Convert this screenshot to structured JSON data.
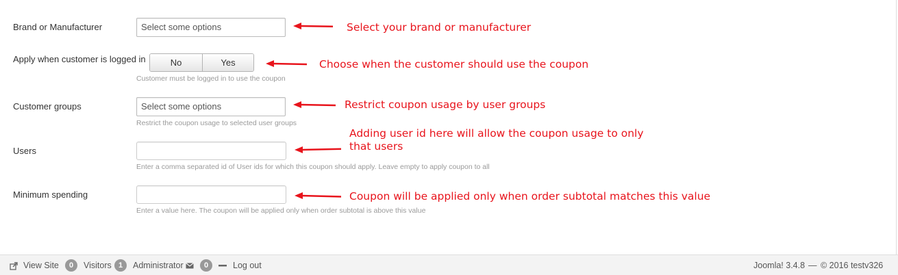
{
  "form": {
    "brand": {
      "label": "Brand or Manufacturer",
      "placeholder": "Select some options"
    },
    "logged_in": {
      "label": "Apply when customer is logged in",
      "options": [
        "No",
        "Yes"
      ],
      "help": "Customer must be logged in to use the coupon"
    },
    "customer_groups": {
      "label": "Customer groups",
      "placeholder": "Select some options",
      "help": "Restrict the coupon usage to selected user groups"
    },
    "users": {
      "label": "Users",
      "value": "",
      "help": "Enter a comma separated id of User ids for which this coupon should apply. Leave empty to apply coupon to all"
    },
    "minimum_spending": {
      "label": "Minimum spending",
      "value": "",
      "help": "Enter a value here. The coupon will be applied only when order subtotal is above this value"
    }
  },
  "annotations": {
    "brand": "Select your brand or manufacturer",
    "logged_in": "Choose when the customer should use the coupon",
    "groups": "Restrict coupon usage by user groups",
    "users_line1": "Adding user id here will allow the coupon usage to only",
    "users_line2": "that users",
    "minimum": "Coupon will be applied only when order subtotal matches this value",
    "color": "#e8141c"
  },
  "footer": {
    "view_site": "View Site",
    "visitors_count": "0",
    "visitors_label": "Visitors",
    "admin_count": "1",
    "admin_label": "Administrator",
    "messages_count": "0",
    "logout": "Log out",
    "version": "Joomla! 3.4.8",
    "separator": "—",
    "copyright": "© 2016 testv326"
  }
}
